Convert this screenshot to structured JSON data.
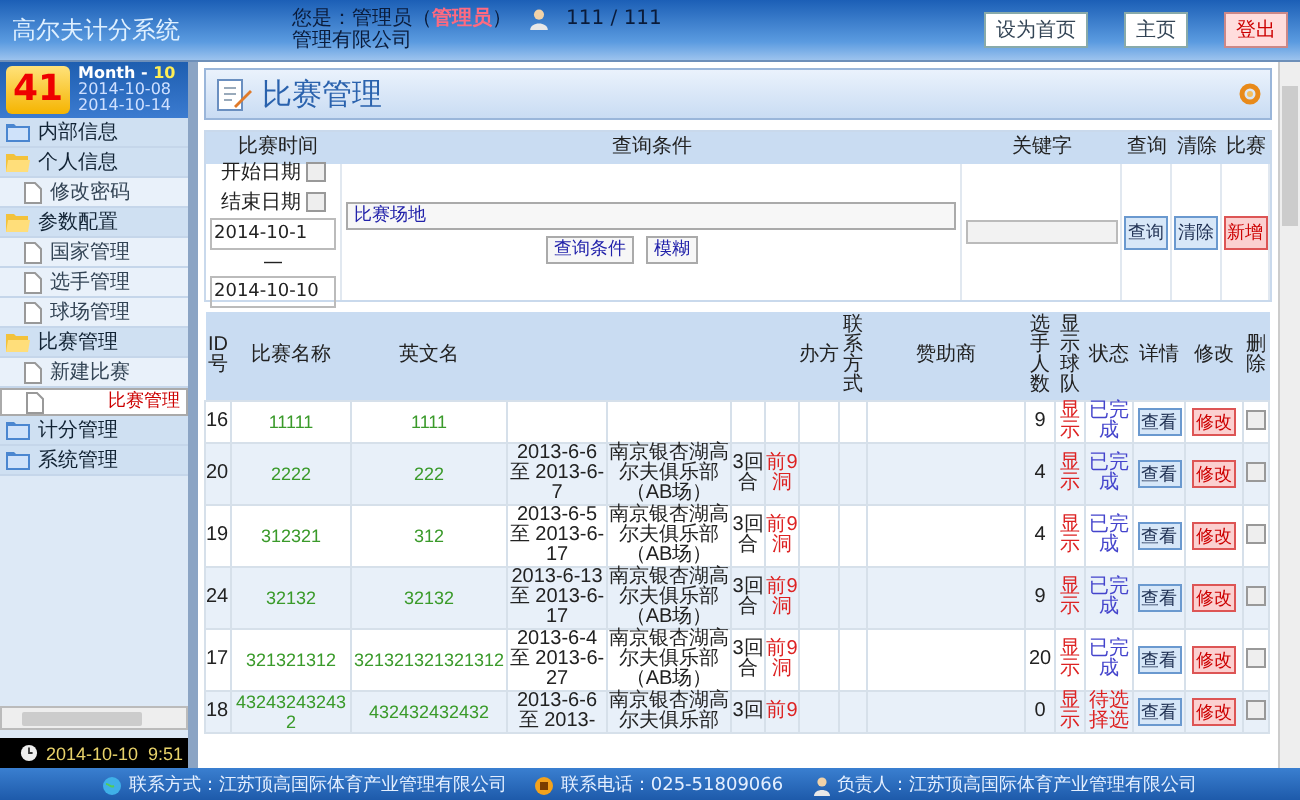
{
  "header": {
    "title": "高尔夫计分系统",
    "user_label": "您是：管理员（",
    "user_role": "管理员",
    "user_close": "）",
    "count": "111 / 111",
    "company": "管理有限公司",
    "buttons": [
      {
        "label": "设为首页",
        "kind": "normal"
      },
      {
        "label": "主页",
        "kind": "normal"
      },
      {
        "label": "登出",
        "kind": "danger"
      }
    ]
  },
  "sidebar": {
    "calendar": {
      "day": "41",
      "month_label": "Month - ",
      "month": "10",
      "start": "2014-10-08",
      "end": "2014-10-14"
    },
    "items": [
      {
        "label": "内部信息",
        "expanded": false
      },
      {
        "label": "个人信息",
        "expanded": true,
        "children": [
          {
            "label": "修改密码",
            "selected": false
          }
        ]
      },
      {
        "label": "参数配置",
        "expanded": true,
        "children": [
          {
            "label": "国家管理",
            "selected": false
          },
          {
            "label": "选手管理",
            "selected": false
          },
          {
            "label": "球场管理",
            "selected": false
          }
        ]
      },
      {
        "label": "比赛管理",
        "expanded": true,
        "children": [
          {
            "label": "新建比赛",
            "selected": false
          },
          {
            "label": "比赛管理",
            "selected": true
          }
        ]
      },
      {
        "label": "计分管理",
        "expanded": false
      },
      {
        "label": "系统管理",
        "expanded": false
      }
    ],
    "clock": "2014-10-10  9:51"
  },
  "page_title": "比赛管理",
  "query": {
    "columns": [
      "比赛时间",
      "查询条件",
      "关键字",
      "查询",
      "清除",
      "比赛"
    ],
    "start_label": "开始日期",
    "start_checked": false,
    "end_label": "结束日期",
    "end_checked": false,
    "start_date": "2014-10-1",
    "separator": "—",
    "end_date": "2014-10-10",
    "venue_select": "比赛场地",
    "condition_select": "查询条件",
    "match_select": "模糊",
    "buttons": [
      {
        "label": "查询",
        "kind": "normal"
      },
      {
        "label": "清除",
        "kind": "normal"
      },
      {
        "label": "新增",
        "kind": "danger"
      }
    ]
  },
  "table": {
    "columns": [
      {
        "label": "ID号"
      },
      {
        "label": "比赛名称"
      },
      {
        "label": "英文名"
      },
      {},
      {},
      {},
      {},
      {
        "label": "办方"
      },
      {
        "label": "联系方式"
      },
      {
        "label": "赞助商"
      },
      {
        "label": "选手人数"
      },
      {
        "label": "显示球队"
      },
      {
        "label": "状态"
      },
      {
        "label": "详情"
      },
      {
        "label": "修改"
      },
      {
        "label": "删除"
      }
    ],
    "rows": [
      {
        "id": "16",
        "name": "11111",
        "english_name": "1111",
        "players": "9",
        "display": "显示",
        "status": {
          "text": "已完成",
          "color": "#4444cc"
        },
        "detail": "查看",
        "edit": "修改",
        "delete_checked": false
      },
      {
        "id": "20",
        "name": "2222",
        "english_name": "222",
        "date": "2013-6-6 至 2013-6-7",
        "venue": "南京银杏湖高尔夫俱乐部（AB场）",
        "rounds": "3回合",
        "holes": "前9洞",
        "players": "4",
        "display": "显示",
        "status": {
          "text": "已完成",
          "color": "#4444cc"
        },
        "detail": "查看",
        "edit": "修改",
        "delete_checked": false
      },
      {
        "id": "19",
        "name": "312321",
        "english_name": "312",
        "date": "2013-6-5 至 2013-6-17",
        "venue": "南京银杏湖高尔夫俱乐部（AB场）",
        "rounds": "3回合",
        "holes": "前9洞",
        "players": "4",
        "display": "显示",
        "status": {
          "text": "已完成",
          "color": "#4444cc"
        },
        "detail": "查看",
        "edit": "修改",
        "delete_checked": false
      },
      {
        "id": "24",
        "name": "32132",
        "english_name": "32132",
        "date": "2013-6-13 至 2013-6-17",
        "venue": "南京银杏湖高尔夫俱乐部（AB场）",
        "rounds": "3回合",
        "holes": "前9洞",
        "players": "9",
        "display": "显示",
        "status": {
          "text": "已完成",
          "color": "#4444cc"
        },
        "detail": "查看",
        "edit": "修改",
        "delete_checked": false
      },
      {
        "id": "17",
        "name": "321321312",
        "english_name": "321321321321312",
        "date": "2013-6-4 至 2013-6-27",
        "venue": "南京银杏湖高尔夫俱乐部（AB场）",
        "rounds": "3回合",
        "holes": "前9洞",
        "players": "20",
        "display": "显示",
        "status": {
          "text": "已完成",
          "color": "#4444cc"
        },
        "detail": "查看",
        "edit": "修改",
        "delete_checked": false
      },
      {
        "id": "18",
        "name": "432432432432",
        "english_name": "432432432432",
        "date": "2013-6-6 至 2013-",
        "venue": "南京银杏湖高尔夫俱乐部",
        "rounds": "3回",
        "holes": "前9",
        "players": "0",
        "display": "显示",
        "status": {
          "text": "待选择选",
          "color": "#dd2222"
        },
        "detail": "查看",
        "edit": "修改",
        "delete_checked": false
      }
    ]
  },
  "footer": [
    {
      "label": "联系方式：江苏顶高国际体育产业管理有限公司",
      "kind": "globe"
    },
    {
      "label": "联系电话：025-51809066",
      "kind": "phone"
    },
    {
      "label": "负责人：江苏顶高国际体育产业管理有限公司",
      "kind": "person"
    }
  ]
}
